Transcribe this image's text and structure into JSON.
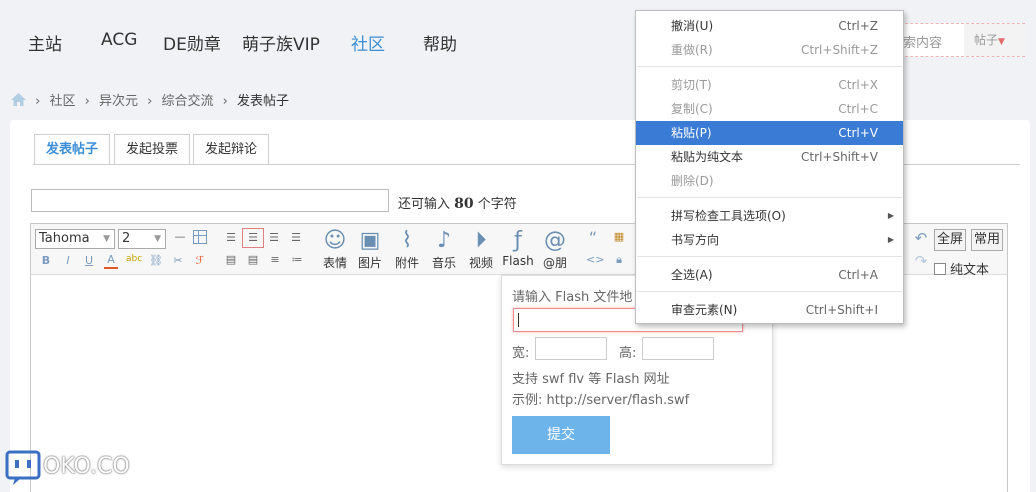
{
  "nav": {
    "items": [
      "主站",
      "ACG",
      "DE勋章",
      "萌子族VIP",
      "社区",
      "帮助"
    ],
    "active_index": 4
  },
  "search": {
    "placeholder": "索内容",
    "scope": "帖子"
  },
  "breadcrumb": [
    "社区",
    "异次元",
    "综合交流",
    "发表帖子"
  ],
  "tabs": [
    "发表帖子",
    "发起投票",
    "发起辩论"
  ],
  "title_field": {
    "value": "",
    "tip_prefix": "还可输入",
    "remaining": "80",
    "tip_suffix": "个字符"
  },
  "toolbar": {
    "font": "Tahoma",
    "size": "2",
    "insert_buttons": [
      "表情",
      "图片",
      "附件",
      "音乐",
      "视频",
      "Flash",
      "@朋"
    ],
    "fullscreen": "全屏",
    "common": "常用",
    "plain_text": "纯文本"
  },
  "flash_popup": {
    "url_label": "请输入 Flash 文件地",
    "width_label": "宽:",
    "height_label": "高:",
    "hint1": "支持 swf flv 等 Flash 网址",
    "hint2": "示例: http://server/flash.swf",
    "submit": "提交"
  },
  "context_menu": {
    "items": [
      {
        "label": "撤消(U)",
        "shortcut": "Ctrl+Z",
        "enabled": true
      },
      {
        "label": "重做(R)",
        "shortcut": "Ctrl+Shift+Z",
        "enabled": false
      },
      {
        "label": "剪切(T)",
        "shortcut": "Ctrl+X",
        "enabled": false
      },
      {
        "label": "复制(C)",
        "shortcut": "Ctrl+C",
        "enabled": false
      },
      {
        "label": "粘贴(P)",
        "shortcut": "Ctrl+V",
        "enabled": true,
        "highlighted": true
      },
      {
        "label": "粘贴为纯文本",
        "shortcut": "Ctrl+Shift+V",
        "enabled": true
      },
      {
        "label": "删除(D)",
        "shortcut": "",
        "enabled": false
      },
      {
        "label": "拼写检查工具选项(O)",
        "shortcut": "",
        "enabled": true,
        "submenu": true
      },
      {
        "label": "书写方向",
        "shortcut": "",
        "enabled": true,
        "submenu": true
      },
      {
        "label": "全选(A)",
        "shortcut": "Ctrl+A",
        "enabled": true
      },
      {
        "label": "审查元素(N)",
        "shortcut": "Ctrl+Shift+I",
        "enabled": true
      }
    ]
  },
  "watermark": "OKO.CO",
  "colors": {
    "accent": "#3b8fd6",
    "menu_highlight": "#3a7bd5",
    "submit": "#6cb4ea"
  }
}
